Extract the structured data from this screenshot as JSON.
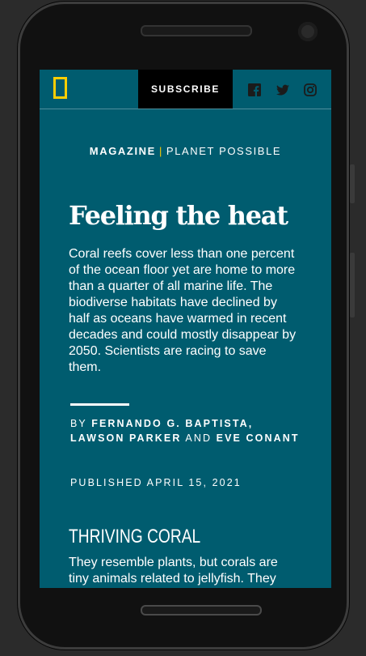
{
  "header": {
    "subscribe_label": "SUBSCRIBE",
    "logo_name": "national-geographic-logo",
    "social": [
      "facebook-icon",
      "twitter-icon",
      "instagram-icon"
    ]
  },
  "article": {
    "kicker": {
      "section": "MAGAZINE",
      "separator": "|",
      "series": "PLANET POSSIBLE"
    },
    "title": "Feeling the heat",
    "dek": "Coral reefs cover less than one percent of the ocean floor yet are home to more than a quarter of all marine life. The biodiverse habitats have declined by half as oceans have warmed in recent decades and could mostly disappear by 2050. Scientists are racing to save them.",
    "byline": {
      "prefix": "BY",
      "author1": "FERNANDO G. BAPTISTA,",
      "author2": "LAWSON PARKER",
      "conjunction": "AND",
      "author3": "EVE CONANT"
    },
    "published": "PUBLISHED APRIL 15, 2021",
    "section_heading": "THRIVING CORAL",
    "body": "They resemble plants, but corals are tiny animals related to jellyfish. They"
  },
  "colors": {
    "background": "#005c6f",
    "accent": "#ffce00",
    "subscribe_bg": "#000000"
  }
}
